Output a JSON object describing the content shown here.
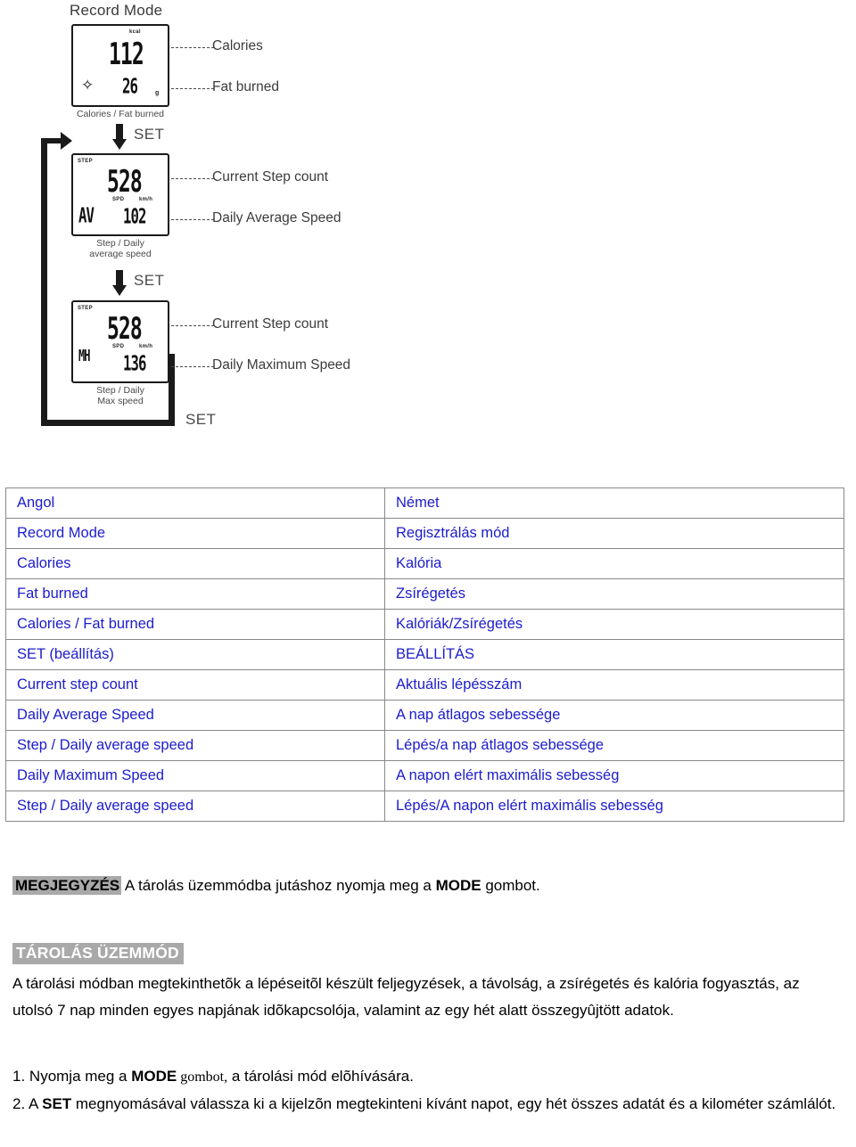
{
  "diagram": {
    "title": "Record Mode",
    "screens": [
      {
        "name": "calories-fat-screen",
        "caption": "Calories / Fat burned",
        "unit_top": "kcal",
        "value_top": "112",
        "value_bottom": "26",
        "unit_bottom": "g",
        "foot_glyph": "footprint",
        "labels": [
          "Calories",
          "Fat burned"
        ]
      },
      {
        "name": "step-avg-speed-screen",
        "caption_line1": "Step / Daily",
        "caption_line2": "average speed",
        "mode_tag": "STEP",
        "value_top": "528",
        "spd_tag": "SPD",
        "unit": "km/h",
        "av_tag": "AV",
        "value_bottom": "102",
        "labels": [
          "Current Step count",
          "Daily Average Speed"
        ]
      },
      {
        "name": "step-max-speed-screen",
        "caption_line1": "Step / Daily",
        "caption_line2": "Max speed",
        "mode_tag": "STEP",
        "value_top": "528",
        "spd_tag": "SPD",
        "unit": "km/h",
        "av_tag": "MH",
        "value_bottom": "136",
        "labels": [
          "Current Step count",
          "Daily Maximum Speed"
        ]
      }
    ],
    "set_label": "SET"
  },
  "table": {
    "header": {
      "left": "Angol",
      "right": "Német"
    },
    "rows": [
      {
        "en": "Record Mode",
        "hu": "Regisztrálás mód"
      },
      {
        "en": "Calories",
        "hu": "Kalória"
      },
      {
        "en": "Fat burned",
        "hu": "Zsírégetés"
      },
      {
        "en": "Calories / Fat burned",
        "hu": "Kalóriák/Zsírégetés"
      },
      {
        "en": "SET (beállítás)",
        "hu": "BEÁLLÍTÁS"
      },
      {
        "en": "Current step count",
        "hu": "Aktuális lépésszám"
      },
      {
        "en": "Daily Average Speed",
        "hu": "A nap átlagos sebessége"
      },
      {
        "en": "Step / Daily average speed",
        "hu": "Lépés/a nap átlagos sebessége"
      },
      {
        "en": "Daily Maximum Speed",
        "hu": "A napon elért maximális sebesség"
      },
      {
        "en": "Step / Daily average speed",
        "hu": "Lépés/A napon elért maximális sebesség"
      }
    ]
  },
  "note": {
    "badge": "MEGJEGYZÉS",
    "text_before": " A tárolás üzemmódba jutáshoz nyomja meg a ",
    "bold_key": "MODE",
    "text_after": " gombot."
  },
  "section": {
    "heading": "TÁROLÁS ÜZEMMÓD",
    "paragraph": "A tárolási módban megtekinthetõk a lépéseitõl készült feljegyzések, a távolság, a zsírégetés és kalória fogyasztás, az utolsó 7 nap minden egyes napjának idõkapcsolója, valamint az egy hét alatt összegyûjtött adatok.",
    "steps": [
      {
        "num": "1.",
        "pre": " Nyomja meg a ",
        "key": "MODE",
        "post": " gombot,",
        "tail": "  a tárolási mód elõhívására."
      },
      {
        "num": "2.",
        "pre": " A ",
        "key": "SET",
        "post": " megnyomásával válassza ki a kijelzõn megtekinteni kívánt napot, egy hét összes adatát és a kilométer számlálót.",
        "tail": ""
      }
    ]
  },
  "colors": {
    "table_text": "#1c1ccc",
    "table_border": "#888888",
    "highlight_bg": "#a9a9a9",
    "diagram_ink": "#1a1a1a"
  }
}
